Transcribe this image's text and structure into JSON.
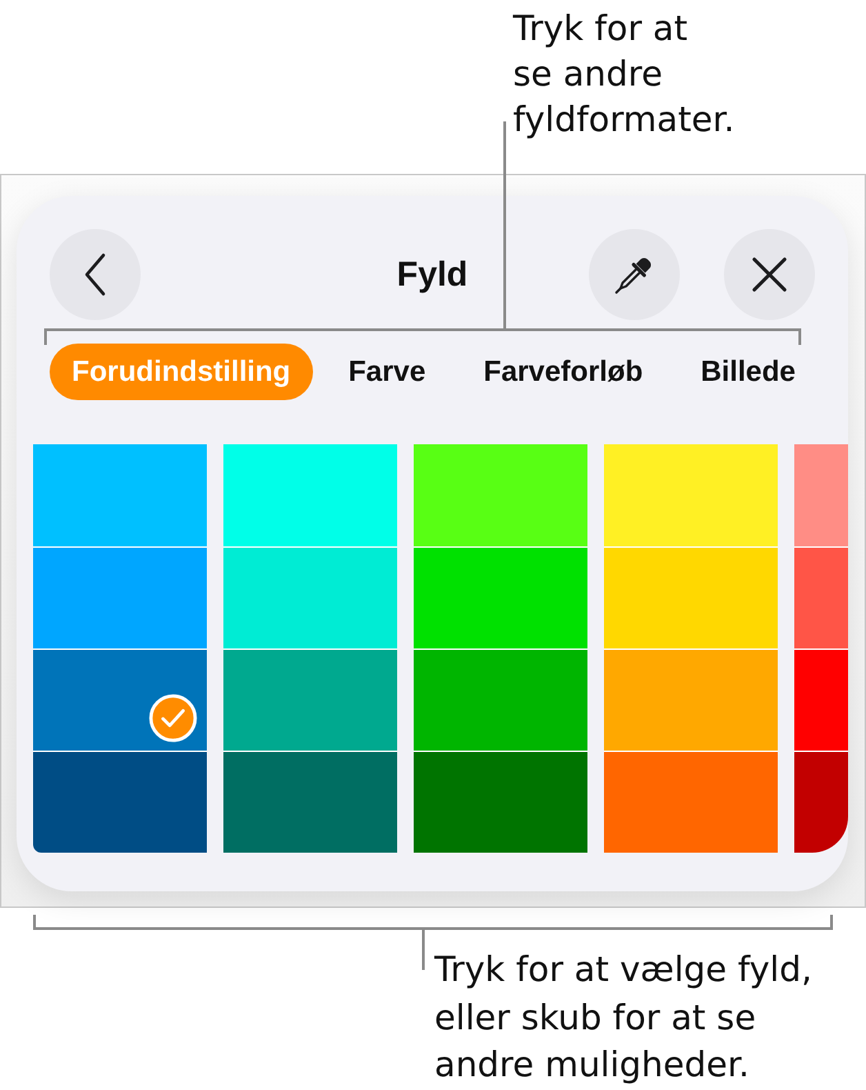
{
  "top_callout": {
    "text": "Tryk for at\nse andre\nfyldformater."
  },
  "panel": {
    "title": "Fyld",
    "tabs": [
      {
        "label": "Forudindstilling",
        "selected": true
      },
      {
        "label": "Farve",
        "selected": false
      },
      {
        "label": "Farveforløb",
        "selected": false
      },
      {
        "label": "Billede",
        "selected": false
      }
    ],
    "swatch_columns": [
      {
        "swatches": [
          {
            "color": "#00c0ff",
            "selected": false
          },
          {
            "color": "#00a6ff",
            "selected": false
          },
          {
            "color": "#0074b9",
            "selected": true
          },
          {
            "color": "#004d85",
            "selected": false
          }
        ]
      },
      {
        "swatches": [
          {
            "color": "#00ffe8",
            "selected": false
          },
          {
            "color": "#00ecd4",
            "selected": false
          },
          {
            "color": "#00a98f",
            "selected": false
          },
          {
            "color": "#006e62",
            "selected": false
          }
        ]
      },
      {
        "swatches": [
          {
            "color": "#58ff14",
            "selected": false
          },
          {
            "color": "#00e100",
            "selected": false
          },
          {
            "color": "#00b500",
            "selected": false
          },
          {
            "color": "#007400",
            "selected": false
          }
        ]
      },
      {
        "swatches": [
          {
            "color": "#fff024",
            "selected": false
          },
          {
            "color": "#ffd800",
            "selected": false
          },
          {
            "color": "#ffa800",
            "selected": false
          },
          {
            "color": "#ff6600",
            "selected": false
          }
        ]
      },
      {
        "swatches": [
          {
            "color": "#ff8d85"
          },
          {
            "color": "#ff5547"
          },
          {
            "color": "#ff0000"
          },
          {
            "color": "#c20000"
          }
        ]
      }
    ]
  },
  "bottom_callout": {
    "text": "Tryk for at vælge fyld,\neller skub for at se\nandre muligheder."
  }
}
